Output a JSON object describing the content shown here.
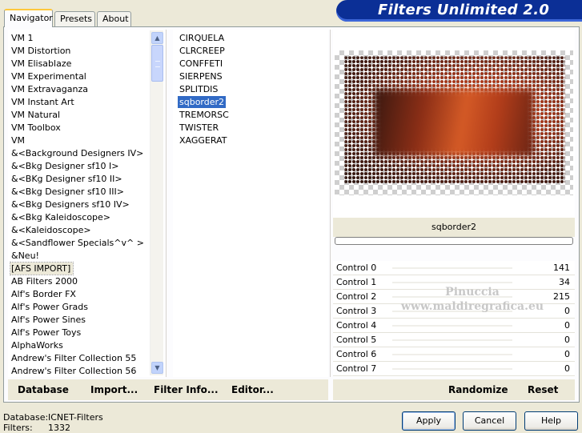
{
  "header": {
    "title": "Filters Unlimited 2.0",
    "tabs": [
      {
        "label": "Navigator",
        "active": true
      },
      {
        "label": "Presets",
        "active": false
      },
      {
        "label": "About",
        "active": false
      }
    ]
  },
  "categories": {
    "items": [
      "VM 1",
      "VM Distortion",
      "VM Elisablaze",
      "VM Experimental",
      "VM Extravaganza",
      "VM Instant Art",
      "VM Natural",
      "VM Toolbox",
      "VM",
      "&<Background Designers IV>",
      "&<Bkg Designer sf10 I>",
      "&<BKg Designer sf10 II>",
      "&<Bkg Designer sf10 III>",
      "&<Bkg Designers sf10 IV>",
      "&<Bkg Kaleidoscope>",
      "&<Kaleidoscope>",
      "&<Sandflower Specials^v^ >",
      "&Neu!",
      "[AFS IMPORT]",
      "AB Filters 2000",
      "Alf's Border FX",
      "Alf's Power Grads",
      "Alf's Power Sines",
      "Alf's Power Toys",
      "AlphaWorks",
      "Andrew's Filter Collection 55",
      "Andrew's Filter Collection 56"
    ],
    "selected": "[AFS IMPORT]"
  },
  "filters": {
    "items": [
      "CIRQUELA",
      "CLRCREEP",
      "CONFFETI",
      "SIERPENS",
      "SPLITDIS",
      "sqborder2",
      "TREMORSC",
      "TWISTER",
      "XAGGERAT"
    ],
    "selected": "sqborder2"
  },
  "preview": {
    "filter_name": "sqborder2",
    "watermark_line1": "Pinuccia",
    "watermark_line2": "www.maldiregrafica.eu"
  },
  "controls": [
    {
      "label": "Control 0",
      "value": "141"
    },
    {
      "label": "Control 1",
      "value": "34"
    },
    {
      "label": "Control 2",
      "value": "215"
    },
    {
      "label": "Control 3",
      "value": "0"
    },
    {
      "label": "Control 4",
      "value": "0"
    },
    {
      "label": "Control 5",
      "value": "0"
    },
    {
      "label": "Control 6",
      "value": "0"
    },
    {
      "label": "Control 7",
      "value": "0"
    }
  ],
  "toolbar": {
    "database": "Database",
    "import": "Import...",
    "filter_info": "Filter Info...",
    "editor": "Editor...",
    "randomize": "Randomize",
    "reset": "Reset"
  },
  "status": {
    "database_label": "Database:",
    "database_value": "ICNET-Filters",
    "filters_label": "Filters:",
    "filters_value": "1332"
  },
  "dialog_buttons": {
    "apply": "Apply",
    "cancel": "Cancel",
    "help": "Help"
  }
}
